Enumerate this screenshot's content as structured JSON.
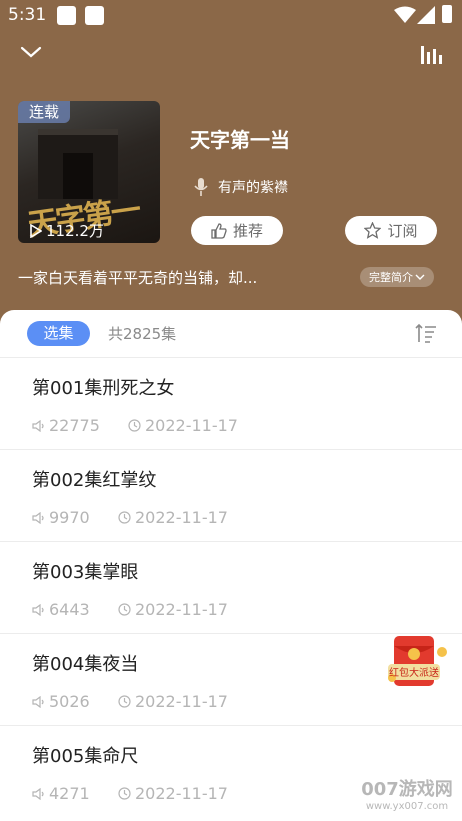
{
  "status": {
    "time": "5:31"
  },
  "book": {
    "badge": "连载",
    "plays": "112.2万",
    "title": "天字第一当",
    "narrator": "有声的紫襟",
    "synopsis": "一家白天看着平平无奇的当铺，却...",
    "full_intro_label": "完整简介",
    "cover_text": "天字第一当"
  },
  "actions": {
    "recommend_label": "推荐",
    "subscribe_label": "订阅"
  },
  "list": {
    "tab_label": "选集",
    "total_label": "共2825集",
    "episodes": [
      {
        "title": "第001集刑死之女",
        "plays": "22775",
        "date": "2022-11-17"
      },
      {
        "title": "第002集红掌纹",
        "plays": "9970",
        "date": "2022-11-17"
      },
      {
        "title": "第003集掌眼",
        "plays": "6443",
        "date": "2022-11-17"
      },
      {
        "title": "第004集夜当",
        "plays": "5026",
        "date": "2022-11-17"
      },
      {
        "title": "第005集命尺",
        "plays": "4271",
        "date": "2022-11-17"
      }
    ]
  },
  "promo": {
    "redpacket_text": "红包大派送"
  },
  "watermark": {
    "brand": "007游戏网",
    "url": "www.yx007.com"
  },
  "colors": {
    "header_bg": "#8b6848",
    "accent": "#5b8ff5",
    "muted": "#b5b5b5"
  }
}
